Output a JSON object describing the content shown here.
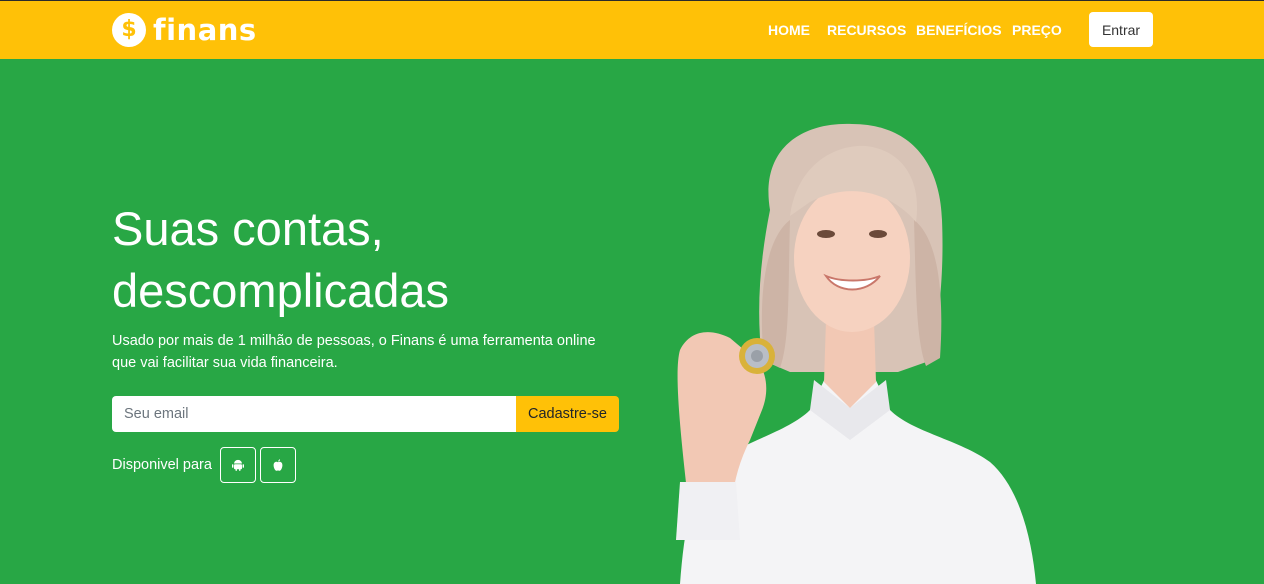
{
  "brand": {
    "symbol": "$",
    "name": "finans"
  },
  "nav": {
    "items": [
      {
        "label": "HOME"
      },
      {
        "label": "RECURSOS"
      },
      {
        "label": "BENEFÍCIOS"
      },
      {
        "label": "PREÇO"
      }
    ],
    "login_label": "Entrar"
  },
  "hero": {
    "title_line1": "Suas contas,",
    "title_line2": "descomplicadas",
    "subtitle": "Usado por mais de 1 milhão de pessoas, o Finans é uma ferramenta online que vai facilitar sua vida financeira.",
    "email_placeholder": "Seu email",
    "signup_label": "Cadastre-se",
    "available_label": "Disponivel para",
    "stores": [
      {
        "icon": "android-icon"
      },
      {
        "icon": "apple-icon"
      }
    ]
  },
  "colors": {
    "navbar": "#ffc107",
    "background": "#28a745",
    "accent_button": "#ffc107"
  }
}
